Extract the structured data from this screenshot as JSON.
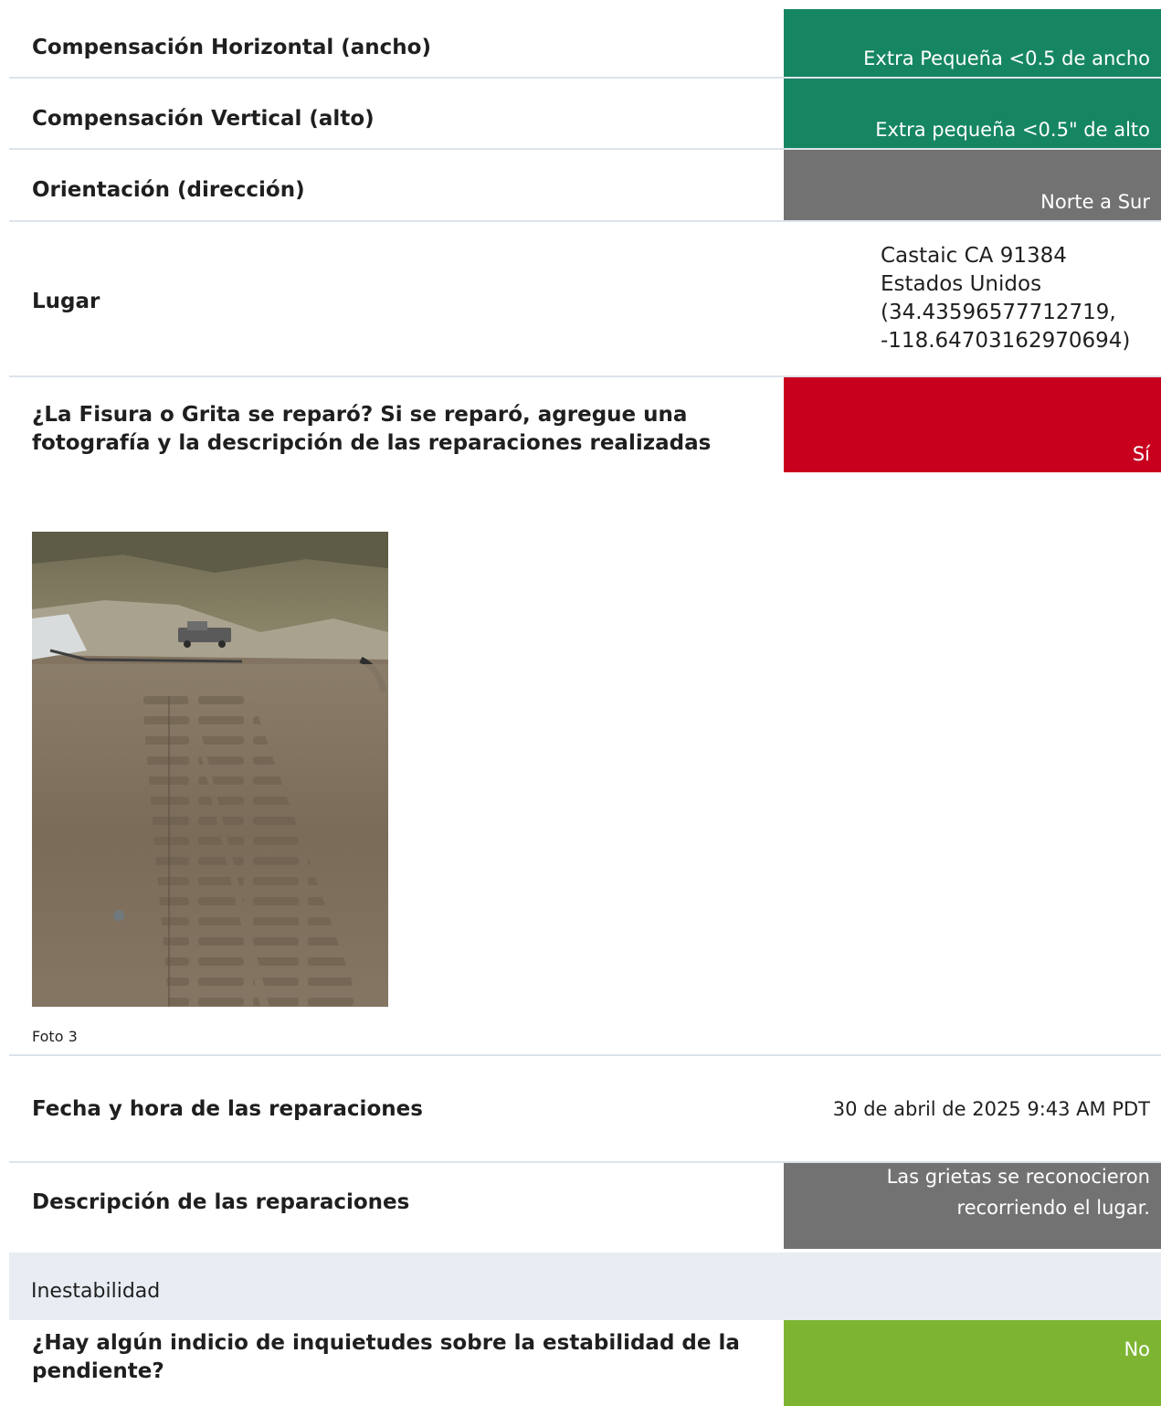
{
  "rows": {
    "horizontal": {
      "label": "Compensación Horizontal (ancho)",
      "value": "Extra Pequeña <0.5 de ancho"
    },
    "vertical": {
      "label": "Compensación Vertical (alto)",
      "value": "Extra pequeña <0.5\" de alto"
    },
    "orientation": {
      "label": "Orientación (dirección)",
      "value": "Norte a Sur"
    },
    "location": {
      "label": "Lugar",
      "lines": [
        "Castaic CA 91384",
        "Estados Unidos",
        "(34.43596577712719,",
        "-118.64703162970694)"
      ]
    },
    "repaired": {
      "label_line1": "¿La Fisura o Grita se reparó? Si se reparó, agregue una",
      "label_line2": "fotografía y la descripción de las reparaciones realizadas",
      "value": "Sí"
    },
    "repair_date": {
      "label": "Fecha y hora de las reparaciones",
      "value": "30 de abril de 2025 9:43 AM PDT"
    },
    "repair_desc": {
      "label": "Descripción de las reparaciones",
      "value_line1": "Las grietas se reconocieron",
      "value_line2": "recorriendo el lugar."
    },
    "stability": {
      "label_line1": "¿Hay algún indicio de inquietudes sobre la estabilidad de la",
      "label_line2": "pendiente?",
      "value": "No"
    }
  },
  "photo": {
    "caption": "Foto 3"
  },
  "section": {
    "title": "Inestabilidad"
  },
  "colors": {
    "green": "#168662",
    "grey": "#727272",
    "red": "#c8001e",
    "lime": "#7db532",
    "divider": "#dde3ea",
    "section_bg": "#e8edf3"
  }
}
